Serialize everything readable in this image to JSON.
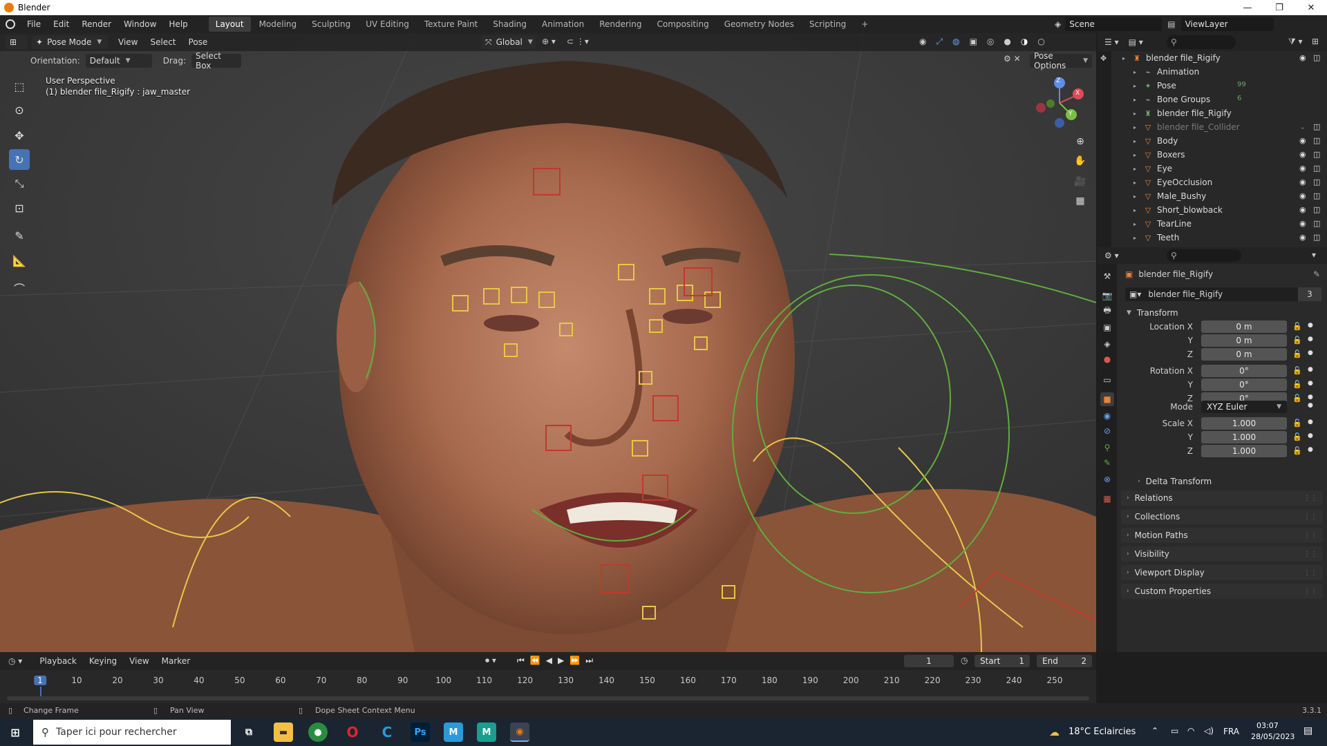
{
  "window": {
    "title": "Blender",
    "min_glyph": "—",
    "max_glyph": "❐",
    "close_glyph": "✕"
  },
  "menu": [
    "File",
    "Edit",
    "Render",
    "Window",
    "Help"
  ],
  "workspaces": [
    "Layout",
    "Modeling",
    "Sculpting",
    "UV Editing",
    "Texture Paint",
    "Shading",
    "Animation",
    "Rendering",
    "Compositing",
    "Geometry Nodes",
    "Scripting",
    "+"
  ],
  "active_workspace": "Layout",
  "scene": {
    "scene_name": "Scene",
    "view_layer": "ViewLayer"
  },
  "viewport_header": {
    "mode": "Pose Mode",
    "menus": [
      "View",
      "Select",
      "Pose"
    ],
    "transform_orientation": "Global",
    "orientation_label": "Orientation:",
    "orientation_value": "Default",
    "drag_label": "Drag:",
    "drag_value": "Select Box",
    "pose_options": "Pose Options"
  },
  "viewport": {
    "perspective": "User Perspective",
    "active_object": "(1) blender file_Rigify : jaw_master",
    "gizmo_axes": {
      "x": "X",
      "y": "Y",
      "z": "Z"
    }
  },
  "tools": [
    "select-box-icon",
    "cursor-icon",
    "move-icon",
    "rotate-icon",
    "scale-icon",
    "transform-icon",
    "annotate-icon",
    "measure-icon",
    "relax-icon"
  ],
  "outliner": {
    "search_placeholder": "",
    "rows": [
      {
        "label": "blender file_Rigify",
        "level": 0,
        "icon": "armature-icon",
        "color": "#e8833a",
        "visible": true
      },
      {
        "label": "Animation",
        "level": 1,
        "icon": "action-icon",
        "color": "#aaaaaa",
        "visible": null
      },
      {
        "label": "Pose",
        "level": 1,
        "icon": "pose-icon",
        "color": "#6aa86a",
        "badge": "99",
        "visible": null
      },
      {
        "label": "Bone Groups",
        "level": 1,
        "icon": "bone-groups-icon",
        "color": "#aaaaaa",
        "badge": "6",
        "visible": null
      },
      {
        "label": "blender file_Rigify",
        "level": 1,
        "icon": "armature-data-icon",
        "color": "#6aa86a",
        "visible": null
      },
      {
        "label": "blender file_Collider",
        "level": 1,
        "icon": "mesh-object-icon",
        "color": "#e8833a",
        "dim": true,
        "visible": false
      },
      {
        "label": "Body",
        "level": 1,
        "icon": "mesh-object-icon",
        "color": "#e8833a",
        "visible": true
      },
      {
        "label": "Boxers",
        "level": 1,
        "icon": "mesh-object-icon",
        "color": "#e8833a",
        "visible": true
      },
      {
        "label": "Eye",
        "level": 1,
        "icon": "mesh-object-icon",
        "color": "#e8833a",
        "visible": true
      },
      {
        "label": "EyeOcclusion",
        "level": 1,
        "icon": "mesh-object-icon",
        "color": "#e8833a",
        "visible": true
      },
      {
        "label": "Male_Bushy",
        "level": 1,
        "icon": "mesh-object-icon",
        "color": "#e8833a",
        "visible": true
      },
      {
        "label": "Short_blowback",
        "level": 1,
        "icon": "mesh-object-icon",
        "color": "#e8833a",
        "visible": true
      },
      {
        "label": "TearLine",
        "level": 1,
        "icon": "mesh-object-icon",
        "color": "#e8833a",
        "visible": true
      },
      {
        "label": "Teeth",
        "level": 1,
        "icon": "mesh-object-icon",
        "color": "#e8833a",
        "visible": true
      }
    ]
  },
  "properties": {
    "object_name": "blender file_Rigify",
    "datablock_name": "blender file_Rigify",
    "datablock_users": "3",
    "transform": {
      "title": "Transform",
      "location_label": "Location X",
      "location": [
        "0 m",
        "0 m",
        "0 m"
      ],
      "rotation_label": "Rotation X",
      "rotation": [
        "0°",
        "0°",
        "0°"
      ],
      "mode_label": "Mode",
      "mode": "XYZ Euler",
      "scale_label": "Scale X",
      "scale": [
        "1.000",
        "1.000",
        "1.000"
      ],
      "y_label": "Y",
      "z_label": "Z"
    },
    "delta_transform": "Delta Transform",
    "panels": [
      "Relations",
      "Collections",
      "Motion Paths",
      "Visibility",
      "Viewport Display",
      "Custom Properties"
    ]
  },
  "timeline": {
    "menus": [
      "Playback",
      "Keying",
      "View",
      "Marker"
    ],
    "current_frame": "1",
    "start_label": "Start",
    "start": "1",
    "end_label": "End",
    "end": "2",
    "ticks": [
      "1",
      "10",
      "20",
      "30",
      "40",
      "50",
      "60",
      "70",
      "80",
      "90",
      "100",
      "110",
      "120",
      "130",
      "140",
      "150",
      "160",
      "170",
      "180",
      "190",
      "200",
      "210",
      "220",
      "230",
      "240",
      "250"
    ]
  },
  "status_bar": {
    "left": "Change Frame",
    "middle": "Pan View",
    "right": "Dope Sheet Context Menu",
    "version": "3.3.1"
  },
  "taskbar": {
    "search_placeholder": "Taper ici pour rechercher",
    "weather": "18°C Eclaircies",
    "language": "FRA",
    "time": "03:07",
    "date": "28/05/2023"
  },
  "colors": {
    "accent": "#4772b3",
    "blender_orange": "#e87d0d",
    "selected_bone": "#e6c84a",
    "bone_red": "#c0392b",
    "bone_green": "#5fae3c"
  }
}
